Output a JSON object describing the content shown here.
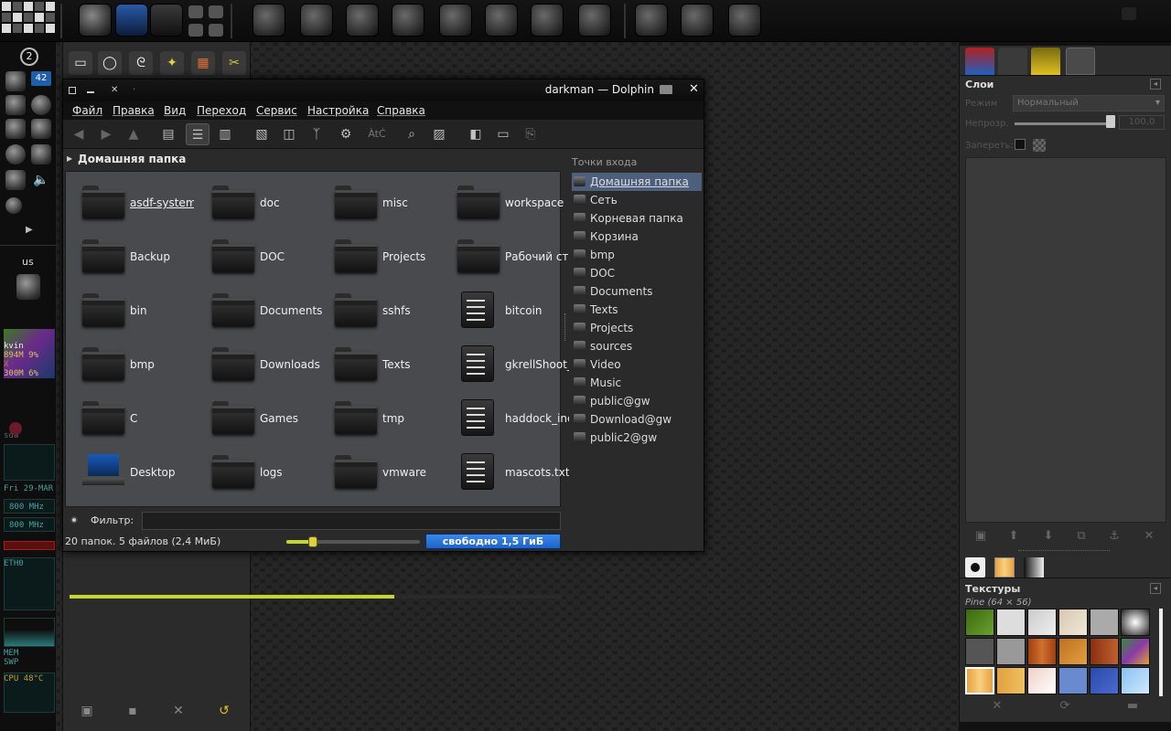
{
  "dolphin": {
    "title": "darkman — Dolphin",
    "menu": [
      "Файл",
      "Правка",
      "Вид",
      "Переход",
      "Сервис",
      "Настройка",
      "Справка"
    ],
    "location": "Домашняя папка",
    "files": [
      {
        "name": "asdf-systems",
        "kind": "folder"
      },
      {
        "name": "doc",
        "kind": "folder"
      },
      {
        "name": "misc",
        "kind": "folder"
      },
      {
        "name": "workspace",
        "kind": "folder"
      },
      {
        "name": "Backup",
        "kind": "folder"
      },
      {
        "name": "DOC",
        "kind": "folder"
      },
      {
        "name": "Projects",
        "kind": "folder"
      },
      {
        "name": "Рабочий стол",
        "kind": "folder"
      },
      {
        "name": "bin",
        "kind": "folder"
      },
      {
        "name": "Documents",
        "kind": "folder"
      },
      {
        "name": "sshfs",
        "kind": "folder"
      },
      {
        "name": "bitcoin",
        "kind": "text-file"
      },
      {
        "name": "bmp",
        "kind": "folder"
      },
      {
        "name": "Downloads",
        "kind": "folder"
      },
      {
        "name": "Texts",
        "kind": "folder"
      },
      {
        "name": "gkrellShoot_",
        "kind": "image-file"
      },
      {
        "name": "C",
        "kind": "folder"
      },
      {
        "name": "Games",
        "kind": "folder"
      },
      {
        "name": "tmp",
        "kind": "folder"
      },
      {
        "name": "haddock_inc",
        "kind": "text-file"
      },
      {
        "name": "Desktop",
        "kind": "desktop-folder"
      },
      {
        "name": "logs",
        "kind": "folder"
      },
      {
        "name": "vmware",
        "kind": "folder"
      },
      {
        "name": "mascots.txt",
        "kind": "text-file"
      }
    ],
    "places_title": "Точки входа",
    "places": [
      "Домашняя папка",
      "Сеть",
      "Корневая папка",
      "Корзина",
      "bmp",
      "DOC",
      "Documents",
      "Texts",
      "Projects",
      "sources",
      "Video",
      "Music",
      "public@gw",
      "Download@gw",
      "public2@gw"
    ],
    "filter_label": "Фильтр:",
    "filter_value": "",
    "status_text": "20 папок. 5 файлов (2,4 МиБ)",
    "free_space": "свободно 1,5 ГиБ",
    "zoom_level": 0.2,
    "scan_progress": 0.66
  },
  "toolbar_icons": [
    "back-icon",
    "forward-icon",
    "up-icon",
    "icons-view-icon",
    "details-view-icon",
    "columns-view-icon",
    "preview-icon",
    "split-icon",
    "filter-icon",
    "settings-icon",
    "spellcheck-icon",
    "search-icon",
    "image-icon",
    "terminal-icon",
    "panels-icon",
    "network-icon"
  ],
  "left_dock": {
    "badge_2": "2",
    "badge_42": "42",
    "keyboard_layout": "us",
    "monitor_lines": [
      "kvin",
      "894M   9%",
      "X",
      "300M   6%"
    ],
    "sda": "sda",
    "date": "Fri 29-MAR",
    "cpu_freq_1": "800 MHz",
    "cpu_freq_2": "800 MHz",
    "eth": "ETH0",
    "mem": "MEM",
    "swp": "SWP",
    "cpu_temp": "CPU   48°C"
  },
  "layers_dock": {
    "title": "Слои",
    "mode_label": "Режим",
    "mode_value": "Нормальный",
    "opacity_label": "Непрозр.",
    "opacity_value": "100,0",
    "lock_label": "Запереть:",
    "textures_title": "Текстуры",
    "texture_selected": "Pine (64 × 56)"
  },
  "colors": {
    "accent_yellow": "#c6d62b",
    "free_space_bar": "#1d63c8",
    "selection": "#4d5f7d"
  }
}
